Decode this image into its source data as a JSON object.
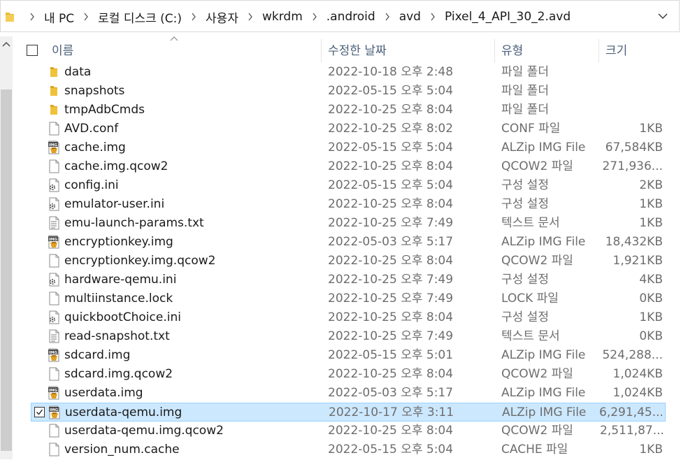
{
  "address_bar": {
    "crumbs": [
      "내 PC",
      "로컬 디스크 (C:)",
      "사용자",
      "wkrdm",
      ".android",
      "avd",
      "Pixel_4_API_30_2.avd"
    ]
  },
  "columns": {
    "name": "이름",
    "date": "수정한 날짜",
    "type": "유형",
    "size": "크기"
  },
  "files": [
    {
      "name": "data",
      "date": "2022-10-18 오후 2:48",
      "type": "파일 폴더",
      "size": "",
      "icon": "folder"
    },
    {
      "name": "snapshots",
      "date": "2022-05-15 오후 5:04",
      "type": "파일 폴더",
      "size": "",
      "icon": "folder"
    },
    {
      "name": "tmpAdbCmds",
      "date": "2022-10-25 오후 8:04",
      "type": "파일 폴더",
      "size": "",
      "icon": "folder"
    },
    {
      "name": "AVD.conf",
      "date": "2022-10-25 오후 8:02",
      "type": "CONF 파일",
      "size": "1KB",
      "icon": "file"
    },
    {
      "name": "cache.img",
      "date": "2022-05-15 오후 5:04",
      "type": "ALZip IMG File",
      "size": "67,584KB",
      "icon": "img"
    },
    {
      "name": "cache.img.qcow2",
      "date": "2022-10-25 오후 8:04",
      "type": "QCOW2 파일",
      "size": "271,936...",
      "icon": "file"
    },
    {
      "name": "config.ini",
      "date": "2022-05-15 오후 5:04",
      "type": "구성 설정",
      "size": "2KB",
      "icon": "ini"
    },
    {
      "name": "emulator-user.ini",
      "date": "2022-10-25 오후 8:04",
      "type": "구성 설정",
      "size": "1KB",
      "icon": "ini"
    },
    {
      "name": "emu-launch-params.txt",
      "date": "2022-10-25 오후 7:49",
      "type": "텍스트 문서",
      "size": "1KB",
      "icon": "txt"
    },
    {
      "name": "encryptionkey.img",
      "date": "2022-05-03 오후 5:17",
      "type": "ALZip IMG File",
      "size": "18,432KB",
      "icon": "img"
    },
    {
      "name": "encryptionkey.img.qcow2",
      "date": "2022-10-25 오후 8:04",
      "type": "QCOW2 파일",
      "size": "1,921KB",
      "icon": "file"
    },
    {
      "name": "hardware-qemu.ini",
      "date": "2022-10-25 오후 7:49",
      "type": "구성 설정",
      "size": "4KB",
      "icon": "ini"
    },
    {
      "name": "multiinstance.lock",
      "date": "2022-10-25 오후 7:49",
      "type": "LOCK 파일",
      "size": "0KB",
      "icon": "file"
    },
    {
      "name": "quickbootChoice.ini",
      "date": "2022-10-25 오후 8:04",
      "type": "구성 설정",
      "size": "1KB",
      "icon": "ini"
    },
    {
      "name": "read-snapshot.txt",
      "date": "2022-10-25 오후 7:49",
      "type": "텍스트 문서",
      "size": "0KB",
      "icon": "txt"
    },
    {
      "name": "sdcard.img",
      "date": "2022-05-15 오후 5:01",
      "type": "ALZip IMG File",
      "size": "524,288...",
      "icon": "img"
    },
    {
      "name": "sdcard.img.qcow2",
      "date": "2022-10-25 오후 8:04",
      "type": "QCOW2 파일",
      "size": "1,024KB",
      "icon": "file"
    },
    {
      "name": "userdata.img",
      "date": "2022-05-03 오후 5:17",
      "type": "ALZip IMG File",
      "size": "1,024KB",
      "icon": "img"
    },
    {
      "name": "userdata-qemu.img",
      "date": "2022-10-17 오후 3:11",
      "type": "ALZip IMG File",
      "size": "6,291,45...",
      "icon": "img",
      "selected": true
    },
    {
      "name": "userdata-qemu.img.qcow2",
      "date": "2022-10-25 오후 8:04",
      "type": "QCOW2 파일",
      "size": "2,511,87...",
      "icon": "file"
    },
    {
      "name": "version_num.cache",
      "date": "2022-05-15 오후 5:04",
      "type": "CACHE 파일",
      "size": "1KB",
      "icon": "file"
    }
  ],
  "colors": {
    "selection_bg": "#cce8ff",
    "selection_border": "#99d1ff",
    "folder": "#e8b832",
    "header_text": "#4c607a"
  }
}
